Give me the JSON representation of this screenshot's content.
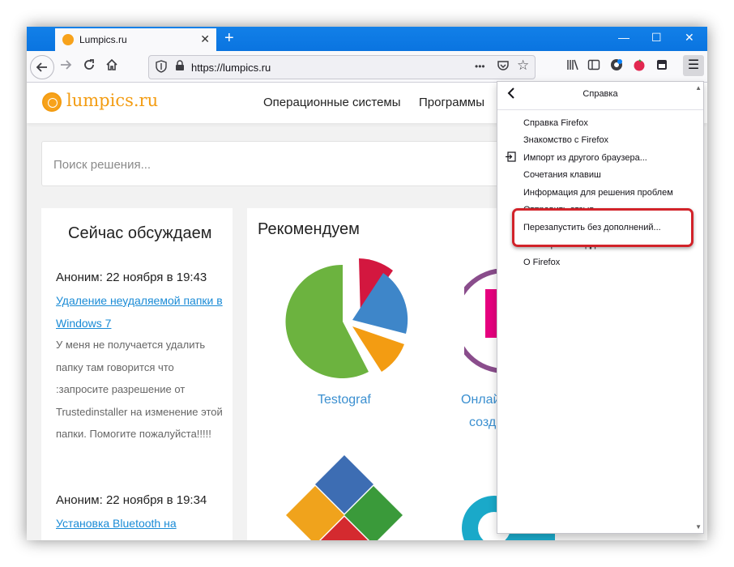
{
  "browser": {
    "tab": {
      "title": "Lumpics.ru",
      "close": "✕"
    },
    "new_tab": "+",
    "window_controls": {
      "minimize": "—",
      "maximize": "☐",
      "close": "✕"
    },
    "url": "https://lumpics.ru",
    "url_icons": {
      "shield": "shield-icon",
      "lock": "lock-icon",
      "more": "•••",
      "pocket": "pocket-icon",
      "star": "☆"
    },
    "toolbar_icons": [
      "library-icon",
      "sidebar-icon",
      "extension-icon",
      "extension-red-icon",
      "extension-dark-icon"
    ],
    "menu_button": "☰",
    "accent_color": "#0a84ff"
  },
  "site": {
    "logo": "lumpics.ru",
    "logo_color": "#f39c12",
    "nav": [
      "Операционные системы",
      "Программы"
    ],
    "search_placeholder": "Поиск решения...",
    "discussion": {
      "title": "Сейчас обсуждаем",
      "comments": [
        {
          "author": "Аноним: 22 ноября в 19:43",
          "link": "Удаление неудаляемой папки в Windows 7",
          "text": "У меня не получается удалить папку там говорится что :запросите разрешение от Trustedinstaller на изменение этой папки. Помогите пожалуйста!!!!!"
        },
        {
          "author": "Аноним: 22 ноября в 19:34",
          "link": "Установка Bluetooth на"
        }
      ]
    },
    "recommended": {
      "title": "Рекомендуем",
      "items": [
        {
          "label": "Testograf"
        },
        {
          "label": "Онлай"
        },
        {
          "label": "созд"
        }
      ]
    }
  },
  "help_menu": {
    "title": "Справка",
    "items": [
      "Справка Firefox",
      "Знакомство с Firefox",
      "Импорт из другого браузера...",
      "Сочетания клавиш",
      "Информация для решения проблем",
      "Отправить отзыв...",
      "Перезапустить без дополнений...",
      "Сообщить о поддельном сайте...",
      "О Firefox"
    ],
    "highlighted_index": 6
  }
}
